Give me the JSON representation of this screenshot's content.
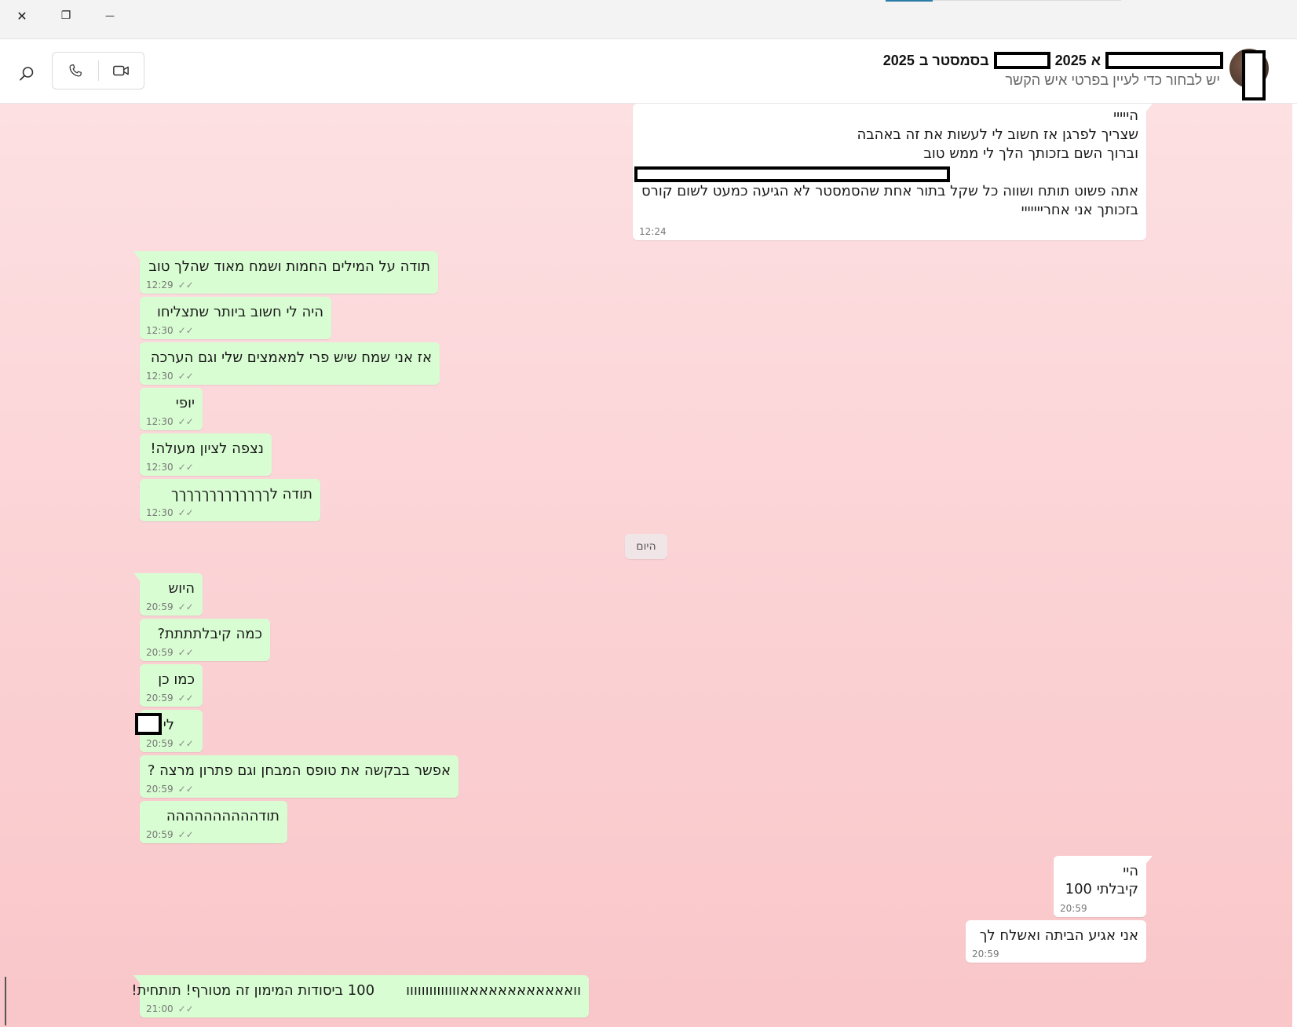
{
  "window": {
    "close_icon": "✕",
    "restore_icon": "❐",
    "minimize_icon": "—"
  },
  "header": {
    "title_year_1": "2025",
    "title_part_a": "א",
    "title_semester": "בסמסטר ב",
    "title_year_2": "2025",
    "subtitle": "יש לבחור כדי לעיין בפרטי איש הקשר"
  },
  "messages": {
    "m1": {
      "text": "הייייי\nשצריך לפרגן אז חשוב לי לעשות את זה באהבה\nוברוך השם בזכותך הלך לי ממש טוב\n\nאתה פשוט תותח ושווה כל שקל בתור אחת שהסמסטר לא הגיעה כמעט לשום קורס\nבזכותך אני אחרייייייי",
      "time": "12:24"
    },
    "m2": {
      "text": "תודה על המילים החמות ושמח מאוד שהלך טוב",
      "time": "12:29"
    },
    "m3": {
      "text": "היה לי חשוב ביותר שתצליחו",
      "time": "12:30"
    },
    "m4": {
      "text": "אז אני שמח שיש פרי למאמצים שלי וגם הערכה",
      "time": "12:30"
    },
    "m5": {
      "text": "יופי",
      "time": "12:30"
    },
    "m6": {
      "text": "נצפה לציון מעולה!",
      "time": "12:30"
    },
    "m7": {
      "text": "תודה לךךךךךךךךךךךךך",
      "time": "12:30"
    },
    "day": "היום",
    "m8": {
      "text": "היוש",
      "time": "20:59"
    },
    "m9": {
      "text": "כמה קיבלתתתת?",
      "time": "20:59"
    },
    "m10": {
      "text": "כמו כן",
      "time": "20:59"
    },
    "m11": {
      "text": "לי",
      "time": "20:59"
    },
    "m12": {
      "text": "אפשר בבקשה את טופס המבחן וגם פתרון מרצה ?",
      "time": "20:59"
    },
    "m13": {
      "text": "תודהההההההההה",
      "time": "20:59"
    },
    "m14": {
      "text": "היי\nקיבלתי 100",
      "time": "20:59"
    },
    "m15": {
      "text": "אני אגיע הביתה ואשלח לך",
      "time": "20:59"
    },
    "m16": {
      "text": "וואאאאאאאאאאאאוווווווווווווו       100 ביסודות המימון זה מטורף! תותחית!",
      "time": "21:00"
    }
  },
  "check_icon": "✓✓"
}
